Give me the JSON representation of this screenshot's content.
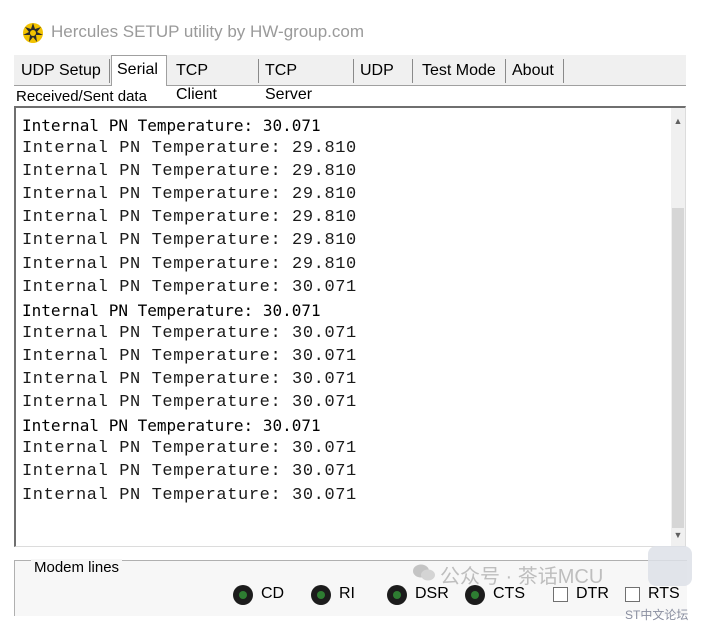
{
  "window": {
    "title": "Hercules SETUP utility by HW-group.com",
    "icon": "hercules-app-icon"
  },
  "tabs": [
    {
      "label": "UDP Setup",
      "active": false
    },
    {
      "label": "Serial",
      "active": true
    },
    {
      "label": "TCP Client",
      "active": false
    },
    {
      "label": "TCP Server",
      "active": false
    },
    {
      "label": "UDP",
      "active": false
    },
    {
      "label": "Test Mode",
      "active": false
    },
    {
      "label": "About",
      "active": false
    }
  ],
  "received": {
    "label": "Received/Sent data",
    "lines": [
      "Internal PN Temperature: 30.071",
      "Internal PN Temperature: 29.810",
      "Internal PN Temperature: 29.810",
      "Internal PN Temperature: 29.810",
      "Internal PN Temperature: 29.810",
      "Internal PN Temperature: 29.810",
      "Internal PN Temperature: 29.810",
      "Internal PN Temperature: 30.071",
      "Internal PN Temperature: 30.071",
      "Internal PN Temperature: 30.071",
      "Internal PN Temperature: 30.071",
      "Internal PN Temperature: 30.071",
      "Internal PN Temperature: 30.071",
      "Internal PN Temperature: 30.071",
      "Internal PN Temperature: 30.071",
      "Internal PN Temperature: 30.071",
      "Internal PN Temperature: 30.071"
    ]
  },
  "modem": {
    "label": "Modem lines",
    "indicators": [
      {
        "label": "CD"
      },
      {
        "label": "RI"
      },
      {
        "label": "DSR"
      },
      {
        "label": "CTS"
      }
    ],
    "controls": [
      {
        "label": "DTR",
        "checked": false
      },
      {
        "label": "RTS",
        "checked": false
      }
    ]
  },
  "watermark": {
    "text": "公众号 · 茶话MCU",
    "sub": "ST中文论坛"
  },
  "colors": {
    "led_on": "#2e7d32",
    "title_text": "#9a9a9a"
  }
}
